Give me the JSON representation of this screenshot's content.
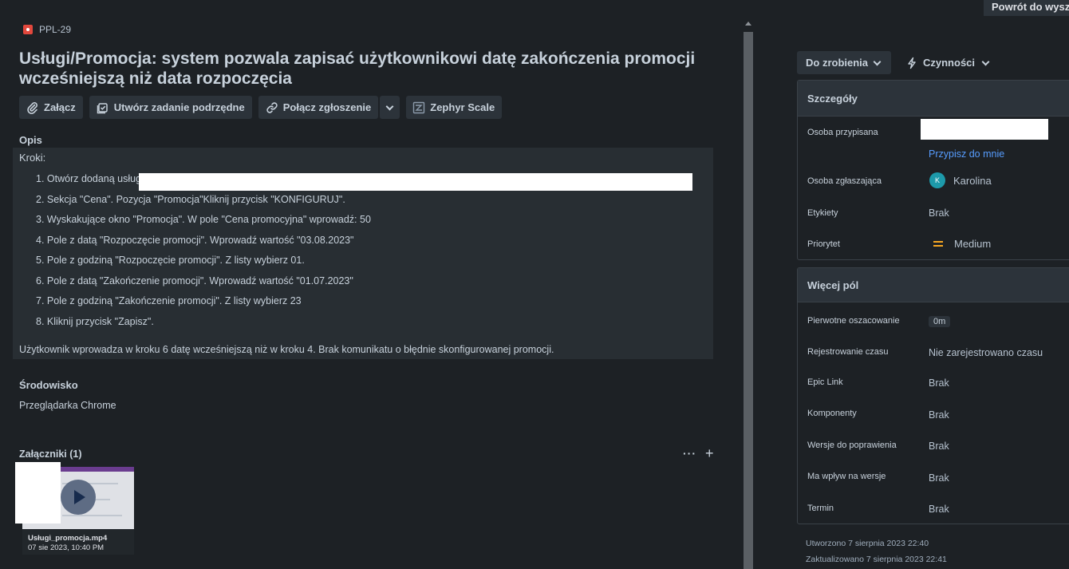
{
  "top_bar": {
    "return_label": "Powrót do wyszu"
  },
  "issue": {
    "key": "PPL-29",
    "title": "Usługi/Promocja: system pozwala zapisać użytkownikowi datę zakończenia promocji wcześniejszą niż data rozpoczęcia"
  },
  "toolbar": {
    "attach": "Załącz",
    "create_subtask": "Utwórz zadanie podrzędne",
    "link_issue": "Połącz zgłoszenie",
    "zephyr": "Zephyr Scale"
  },
  "description": {
    "heading": "Opis",
    "intro": "Kroki:",
    "steps": [
      "1. Otwórz dodaną usługę:",
      "2. Sekcja \"Cena\". Pozycja \"Promocja\"Kliknij przycisk  \"KONFIGURUJ\".",
      "3. Wyskakujące okno \"Promocja\". W pole \"Cena promocyjna\" wprowadź: 50",
      "4. Pole z datą \"Rozpoczęcie promocji\". Wprowadź wartość \"03.08.2023\"",
      "5. Pole z godziną \"Rozpoczęcie promocji\". Z listy wybierz 01.",
      "6. Pole z datą \"Zakończenie promocji\". Wprowadź wartość \"01.07.2023\"",
      "7. Pole z godziną \"Zakończenie promocji\". Z listy wybierz 23",
      "8. Kliknij przycisk \"Zapisz\"."
    ],
    "summary": "Użytkownik wprowadza w kroku 6 datę wcześniejszą niż w kroku 4. Brak komunikatu o błędnie skonfigurowanej promocji."
  },
  "environment": {
    "heading": "Środowisko",
    "value": "Przeglądarka Chrome"
  },
  "attachments": {
    "heading": "Załączniki (1)",
    "more": "···",
    "add": "+",
    "items": [
      {
        "name": "Usługi_promocja.mp4",
        "date": "07 sie 2023, 10:40 PM"
      }
    ]
  },
  "status": {
    "label": "Do zrobienia",
    "actions_label": "Czynności"
  },
  "details": {
    "heading": "Szczegóły",
    "assignee_label": "Osoba przypisana",
    "assign_to_me": "Przypisz do mnie",
    "reporter_label": "Osoba zgłaszająca",
    "reporter_initial": "K",
    "reporter_name": "Karolina",
    "labels_label": "Etykiety",
    "labels_value": "Brak",
    "priority_label": "Priorytet",
    "priority_value": "Medium"
  },
  "more_fields": {
    "heading": "Więcej pól",
    "original_estimate_label": "Pierwotne oszacowanie",
    "original_estimate_value": "0m",
    "time_tracking_label": "Rejestrowanie czasu",
    "time_tracking_value": "Nie zarejestrowano czasu",
    "epic_link_label": "Epic Link",
    "epic_link_value": "Brak",
    "components_label": "Komponenty",
    "components_value": "Brak",
    "fix_versions_label": "Wersje do poprawienia",
    "fix_versions_value": "Brak",
    "affects_versions_label": "Ma wpływ na wersje",
    "affects_versions_value": "Brak",
    "due_date_label": "Termin",
    "due_date_value": "Brak"
  },
  "meta": {
    "created": "Utworzono 7 sierpnia 2023 22:40",
    "updated": "Zaktualizowano 7 sierpnia 2023 22:41"
  },
  "colors": {
    "background": "#1d2125",
    "link": "#579dff",
    "bug": "#e2483d",
    "priority_medium": "#f5a623"
  }
}
